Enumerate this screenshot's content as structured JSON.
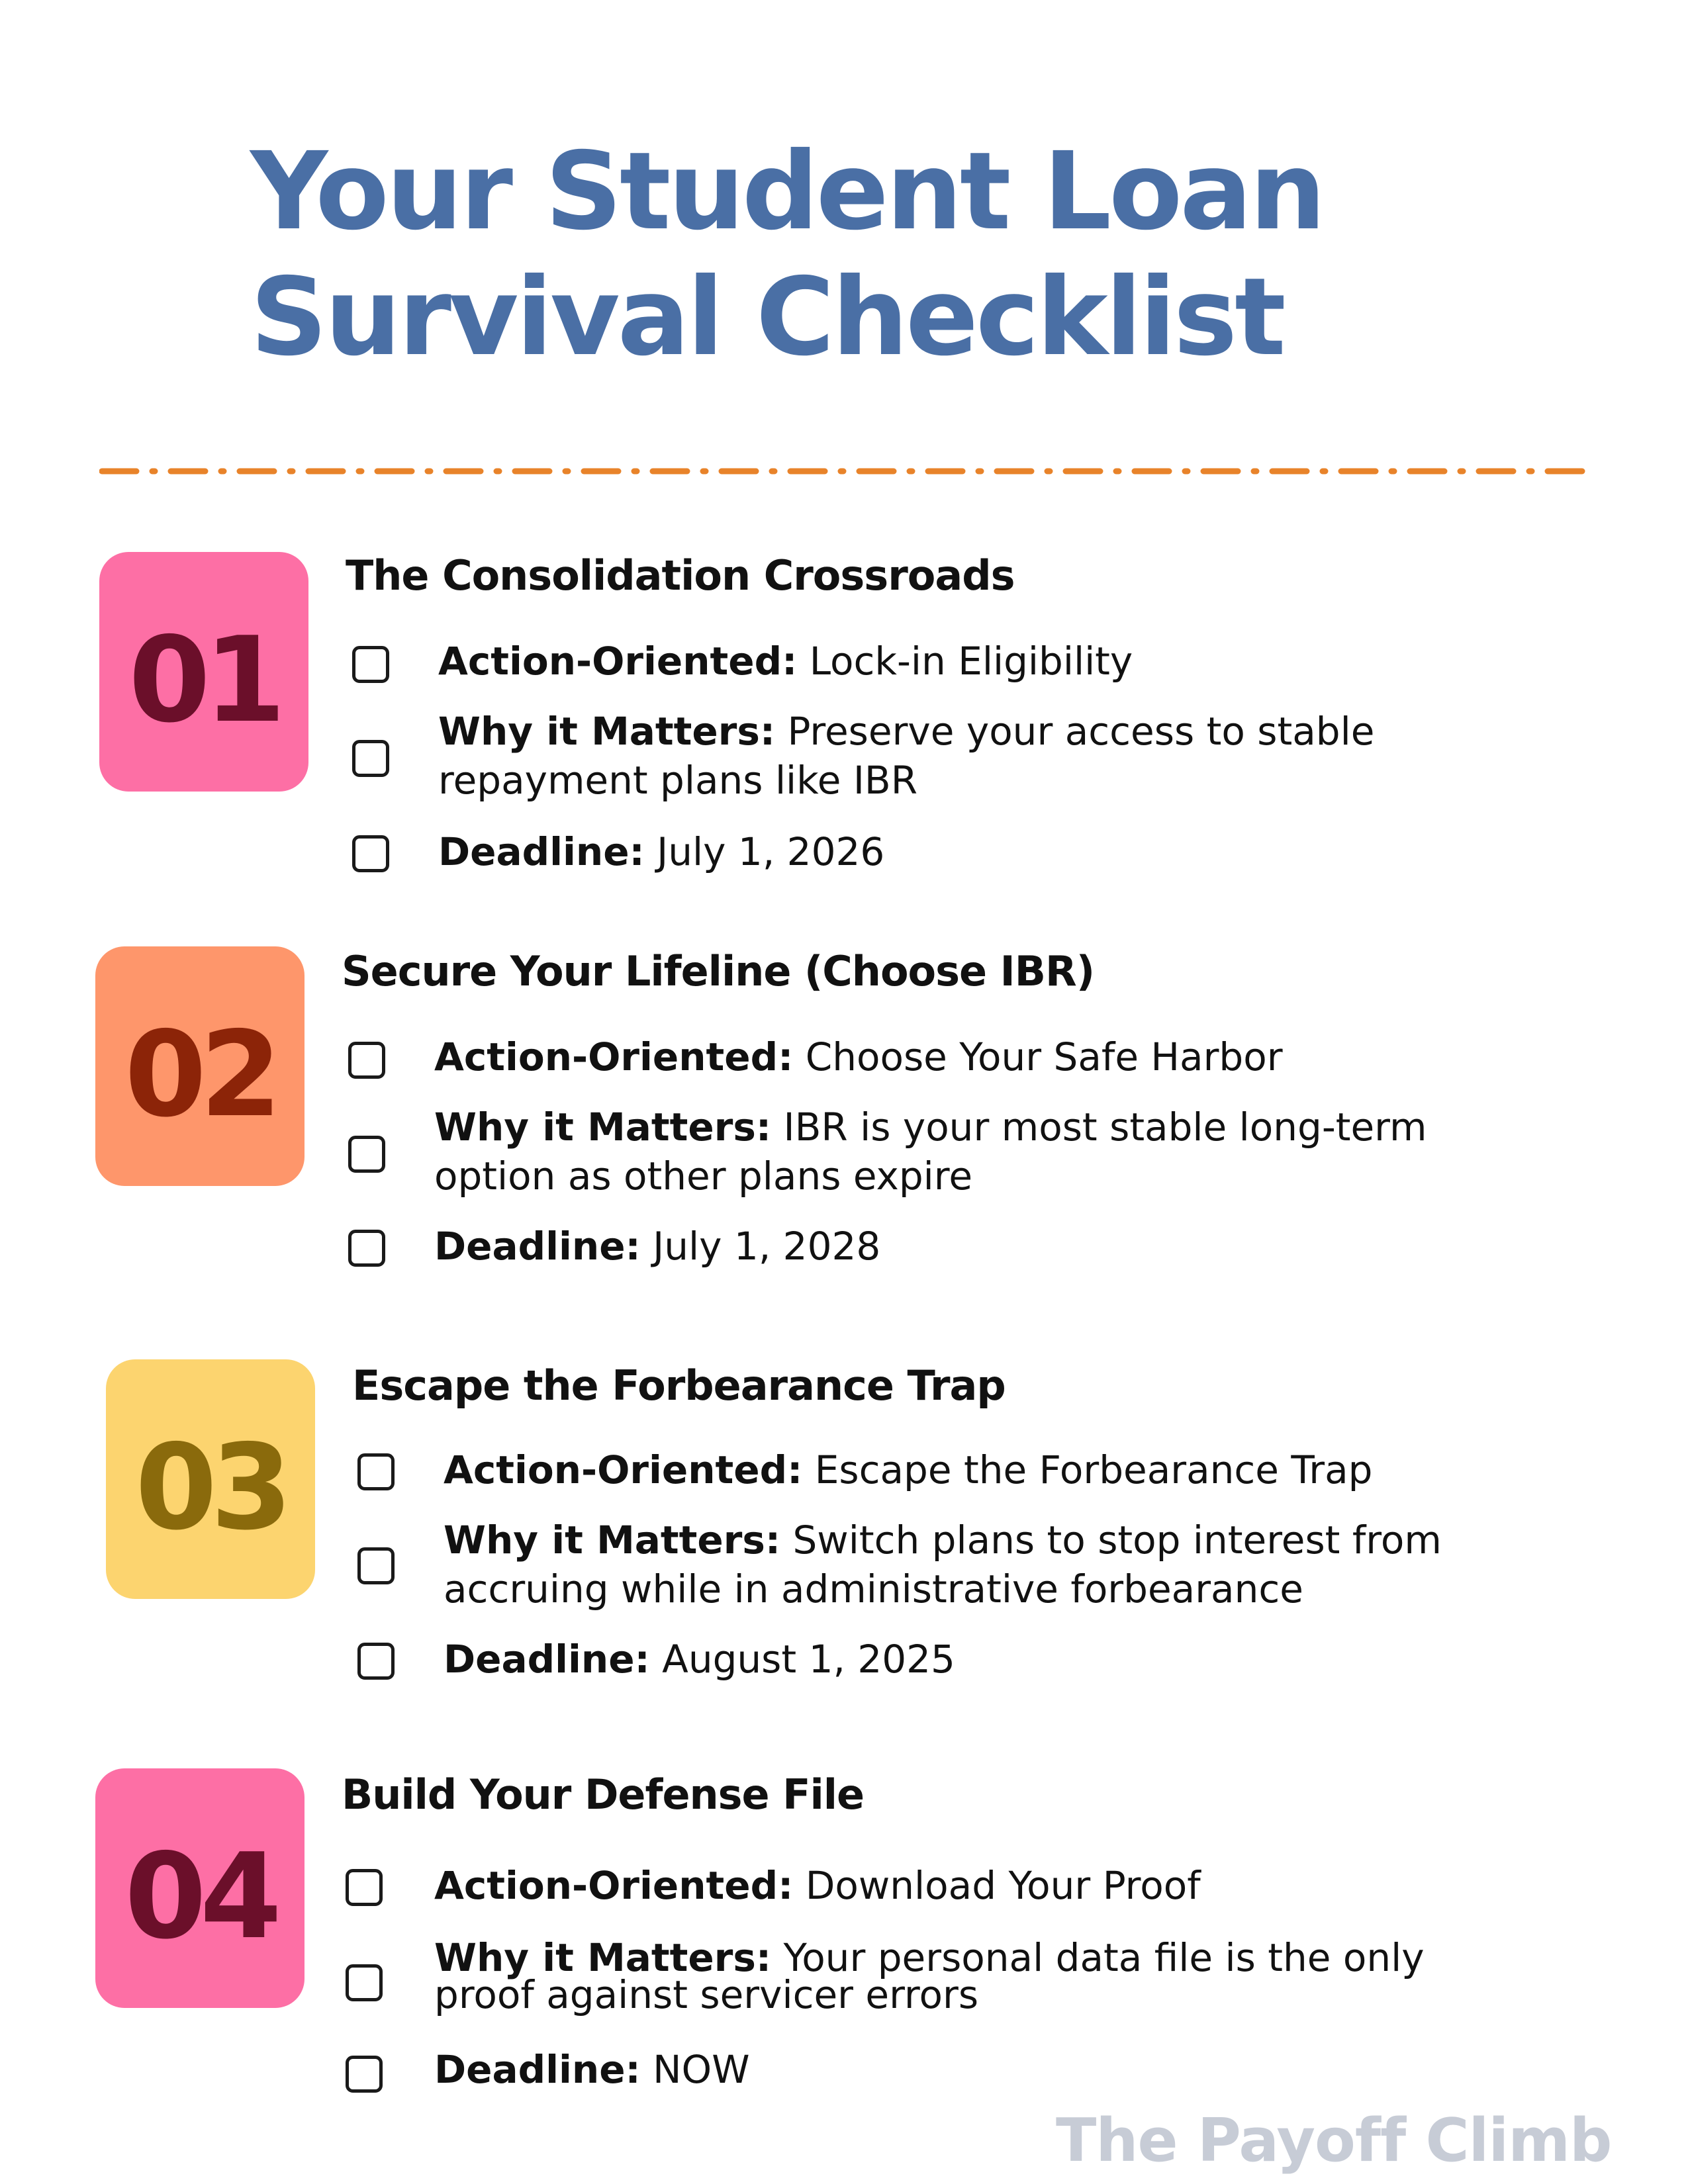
{
  "page": {
    "title_line1": "Your Student Loan",
    "title_line2": "Survival Checklist",
    "watermark": "The Payoff Climb"
  },
  "colors": {
    "title": "#4a6fa5",
    "divider": "#e8832a",
    "watermark": "#c7ccd6"
  },
  "sections": [
    {
      "number": "01",
      "title": "The Consolidation Crossroads",
      "badge_color": "#fd6fa5",
      "number_color": "#6b0f2a",
      "items": [
        {
          "label": "Action-Oriented:",
          "text": " Lock-in Eligibility",
          "checked": false
        },
        {
          "label": "Why it Matters:",
          "text": " Preserve your access to stable",
          "text2": "repayment plans like IBR",
          "checked": false
        },
        {
          "label": "Deadline:",
          "text": " July 1, 2026",
          "checked": false
        }
      ]
    },
    {
      "number": "02",
      "title": "Secure Your Lifeline (Choose IBR)",
      "badge_color": "#fe966b",
      "number_color": "#8c2408",
      "items": [
        {
          "label": "Action-Oriented:",
          "text": " Choose Your Safe Harbor",
          "checked": false
        },
        {
          "label": "Why it Matters:",
          "text": " IBR is your most stable long-term",
          "text2": "option as other plans expire",
          "checked": false
        },
        {
          "label": "Deadline:",
          "text": " July 1, 2028",
          "checked": false
        }
      ]
    },
    {
      "number": "03",
      "title": "Escape the Forbearance Trap",
      "badge_color": "#fcd46f",
      "number_color": "#8a6a0c",
      "items": [
        {
          "label": "Action-Oriented:",
          "text": " Escape the Forbearance Trap",
          "checked": false
        },
        {
          "label": "Why it Matters:",
          "text": " Switch plans to stop interest from",
          "text2": "accruing while in administrative forbearance",
          "checked": false
        },
        {
          "label": "Deadline:",
          "text": " August 1, 2025",
          "checked": false
        }
      ]
    },
    {
      "number": "04",
      "title": "Build Your Defense File",
      "badge_color": "#fd6fa5",
      "number_color": "#6b0f2a",
      "items": [
        {
          "label": "Action-Oriented:",
          "text": " Download Your Proof",
          "checked": false
        },
        {
          "label": "Why it Matters:",
          "text": " Your personal data file is the only",
          "text2": "proof against servicer errors",
          "checked": false
        },
        {
          "label": "Deadline:",
          "text": " NOW",
          "checked": false
        }
      ]
    }
  ]
}
